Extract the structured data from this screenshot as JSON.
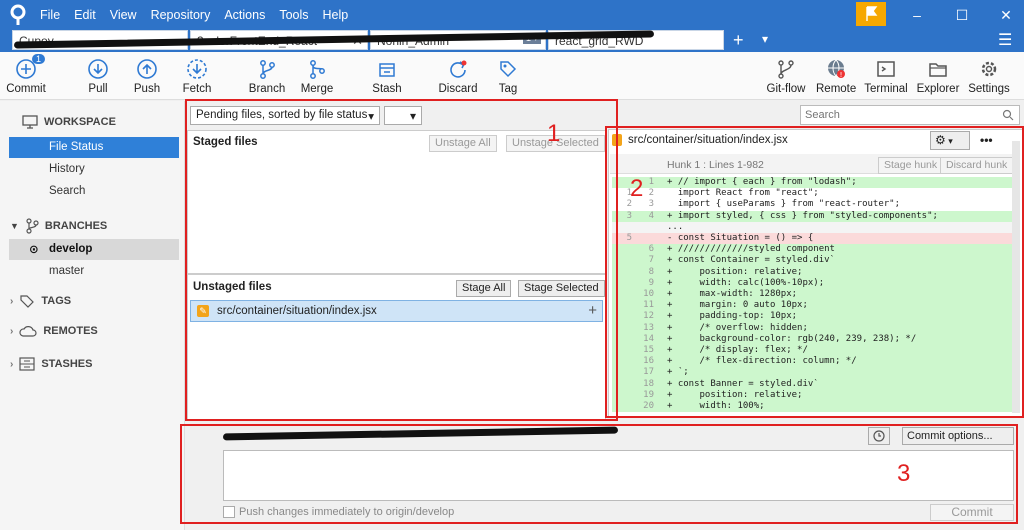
{
  "menu": [
    "File",
    "Edit",
    "View",
    "Repository",
    "Actions",
    "Tools",
    "Help"
  ],
  "window_controls": {
    "minimize": "–",
    "maximize": "☐",
    "close": "✕"
  },
  "tabs": [
    {
      "label": "Cupoy"
    },
    {
      "label": "3colorFrontEnd_React"
    },
    {
      "label": "Nonin_Admin"
    },
    {
      "label": "react_grid_RWD"
    }
  ],
  "tab_new": "+",
  "tab_dropdown": "▾",
  "hamburger": "☰",
  "toolbar": {
    "commit": "Commit",
    "commit_badge": "1",
    "pull": "Pull",
    "push": "Push",
    "fetch": "Fetch",
    "branch": "Branch",
    "merge": "Merge",
    "stash": "Stash",
    "discard": "Discard",
    "tag": "Tag",
    "gitflow": "Git-flow",
    "remote": "Remote",
    "terminal": "Terminal",
    "explorer": "Explorer",
    "settings": "Settings"
  },
  "sidebar": {
    "workspace": "WORKSPACE",
    "file_status": "File Status",
    "history": "History",
    "search": "Search",
    "branches": "BRANCHES",
    "develop": "develop",
    "master": "master",
    "tags": "TAGS",
    "remotes": "REMOTES",
    "stashes": "STASHES"
  },
  "files": {
    "sort_select": "Pending files, sorted by file status",
    "staged_header": "Staged files",
    "unstage_all": "Unstage All",
    "unstage_selected": "Unstage Selected",
    "unstaged_header": "Unstaged files",
    "stage_all": "Stage All",
    "stage_selected": "Stage Selected",
    "unstaged_file": "src/container/situation/index.jsx",
    "add_glyph": "+"
  },
  "search": {
    "placeholder": "Search"
  },
  "diff": {
    "file_path": "src/container/situation/index.jsx",
    "more": "•••",
    "hunk_title": "Hunk 1 : Lines 1-982",
    "stage_hunk": "Stage hunk",
    "discard_hunk": "Discard hunk",
    "lines": [
      {
        "old": "",
        "new": "1",
        "code": "+ // import { each } from \"lodash\";",
        "type": "add"
      },
      {
        "old": "1",
        "new": "2",
        "code": "  import React from \"react\";",
        "type": "ctx"
      },
      {
        "old": "2",
        "new": "3",
        "code": "  import { useParams } from \"react-router\";",
        "type": "ctx"
      },
      {
        "old": "3",
        "new": "4",
        "code": "+ import styled, { css } from \"styled-components\";",
        "type": "add"
      },
      {
        "old": "",
        "new": "",
        "code": "...",
        "type": "sep"
      },
      {
        "old": "5",
        "new": "",
        "code": "- const Situation = () => {",
        "type": "del"
      },
      {
        "old": "",
        "new": "6",
        "code": "+ /////////////styled component",
        "type": "add"
      },
      {
        "old": "",
        "new": "7",
        "code": "+ const Container = styled.div`",
        "type": "add"
      },
      {
        "old": "",
        "new": "8",
        "code": "+     position: relative;",
        "type": "add"
      },
      {
        "old": "",
        "new": "9",
        "code": "+     width: calc(100%-10px);",
        "type": "add"
      },
      {
        "old": "",
        "new": "10",
        "code": "+     max-width: 1280px;",
        "type": "add"
      },
      {
        "old": "",
        "new": "11",
        "code": "+     margin: 0 auto 10px;",
        "type": "add"
      },
      {
        "old": "",
        "new": "12",
        "code": "+     padding-top: 10px;",
        "type": "add"
      },
      {
        "old": "",
        "new": "13",
        "code": "+     /* overflow: hidden;",
        "type": "add"
      },
      {
        "old": "",
        "new": "14",
        "code": "+     background-color: rgb(240, 239, 238); */",
        "type": "add"
      },
      {
        "old": "",
        "new": "15",
        "code": "+     /* display: flex; */",
        "type": "add"
      },
      {
        "old": "",
        "new": "16",
        "code": "+     /* flex-direction: column; */",
        "type": "add"
      },
      {
        "old": "",
        "new": "17",
        "code": "+ `;",
        "type": "add"
      },
      {
        "old": "",
        "new": "18",
        "code": "+ const Banner = styled.div`",
        "type": "add"
      },
      {
        "old": "",
        "new": "19",
        "code": "+     position: relative;",
        "type": "add"
      },
      {
        "old": "",
        "new": "20",
        "code": "+     width: 100%;",
        "type": "add"
      }
    ]
  },
  "commit": {
    "options": "Commit options...",
    "push_checkbox": "Push changes immediately to origin/develop",
    "commit_button": "Commit"
  },
  "annotations": [
    "1",
    "2",
    "3"
  ],
  "colors": {
    "titlebar": "#2e73c8",
    "selected": "#2f80d8",
    "annotation": "#e02020",
    "added": "#cdf7cd",
    "removed": "#fbdada"
  }
}
